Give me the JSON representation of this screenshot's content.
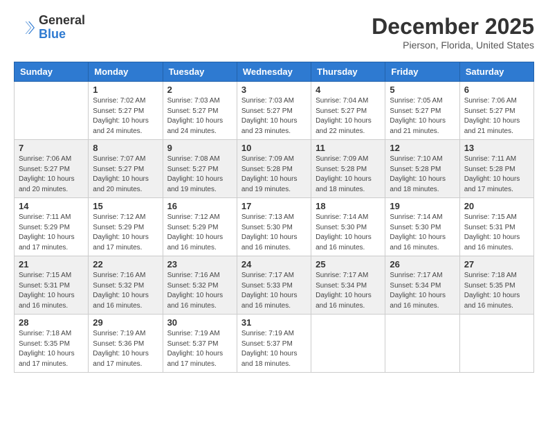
{
  "header": {
    "logo_general": "General",
    "logo_blue": "Blue",
    "month_title": "December 2025",
    "location": "Pierson, Florida, United States"
  },
  "days_of_week": [
    "Sunday",
    "Monday",
    "Tuesday",
    "Wednesday",
    "Thursday",
    "Friday",
    "Saturday"
  ],
  "weeks": [
    [
      {
        "day": "",
        "info": ""
      },
      {
        "day": "1",
        "info": "Sunrise: 7:02 AM\nSunset: 5:27 PM\nDaylight: 10 hours\nand 24 minutes."
      },
      {
        "day": "2",
        "info": "Sunrise: 7:03 AM\nSunset: 5:27 PM\nDaylight: 10 hours\nand 24 minutes."
      },
      {
        "day": "3",
        "info": "Sunrise: 7:03 AM\nSunset: 5:27 PM\nDaylight: 10 hours\nand 23 minutes."
      },
      {
        "day": "4",
        "info": "Sunrise: 7:04 AM\nSunset: 5:27 PM\nDaylight: 10 hours\nand 22 minutes."
      },
      {
        "day": "5",
        "info": "Sunrise: 7:05 AM\nSunset: 5:27 PM\nDaylight: 10 hours\nand 21 minutes."
      },
      {
        "day": "6",
        "info": "Sunrise: 7:06 AM\nSunset: 5:27 PM\nDaylight: 10 hours\nand 21 minutes."
      }
    ],
    [
      {
        "day": "7",
        "info": "Sunrise: 7:06 AM\nSunset: 5:27 PM\nDaylight: 10 hours\nand 20 minutes."
      },
      {
        "day": "8",
        "info": "Sunrise: 7:07 AM\nSunset: 5:27 PM\nDaylight: 10 hours\nand 20 minutes."
      },
      {
        "day": "9",
        "info": "Sunrise: 7:08 AM\nSunset: 5:27 PM\nDaylight: 10 hours\nand 19 minutes."
      },
      {
        "day": "10",
        "info": "Sunrise: 7:09 AM\nSunset: 5:28 PM\nDaylight: 10 hours\nand 19 minutes."
      },
      {
        "day": "11",
        "info": "Sunrise: 7:09 AM\nSunset: 5:28 PM\nDaylight: 10 hours\nand 18 minutes."
      },
      {
        "day": "12",
        "info": "Sunrise: 7:10 AM\nSunset: 5:28 PM\nDaylight: 10 hours\nand 18 minutes."
      },
      {
        "day": "13",
        "info": "Sunrise: 7:11 AM\nSunset: 5:28 PM\nDaylight: 10 hours\nand 17 minutes."
      }
    ],
    [
      {
        "day": "14",
        "info": "Sunrise: 7:11 AM\nSunset: 5:29 PM\nDaylight: 10 hours\nand 17 minutes."
      },
      {
        "day": "15",
        "info": "Sunrise: 7:12 AM\nSunset: 5:29 PM\nDaylight: 10 hours\nand 17 minutes."
      },
      {
        "day": "16",
        "info": "Sunrise: 7:12 AM\nSunset: 5:29 PM\nDaylight: 10 hours\nand 16 minutes."
      },
      {
        "day": "17",
        "info": "Sunrise: 7:13 AM\nSunset: 5:30 PM\nDaylight: 10 hours\nand 16 minutes."
      },
      {
        "day": "18",
        "info": "Sunrise: 7:14 AM\nSunset: 5:30 PM\nDaylight: 10 hours\nand 16 minutes."
      },
      {
        "day": "19",
        "info": "Sunrise: 7:14 AM\nSunset: 5:30 PM\nDaylight: 10 hours\nand 16 minutes."
      },
      {
        "day": "20",
        "info": "Sunrise: 7:15 AM\nSunset: 5:31 PM\nDaylight: 10 hours\nand 16 minutes."
      }
    ],
    [
      {
        "day": "21",
        "info": "Sunrise: 7:15 AM\nSunset: 5:31 PM\nDaylight: 10 hours\nand 16 minutes."
      },
      {
        "day": "22",
        "info": "Sunrise: 7:16 AM\nSunset: 5:32 PM\nDaylight: 10 hours\nand 16 minutes."
      },
      {
        "day": "23",
        "info": "Sunrise: 7:16 AM\nSunset: 5:32 PM\nDaylight: 10 hours\nand 16 minutes."
      },
      {
        "day": "24",
        "info": "Sunrise: 7:17 AM\nSunset: 5:33 PM\nDaylight: 10 hours\nand 16 minutes."
      },
      {
        "day": "25",
        "info": "Sunrise: 7:17 AM\nSunset: 5:34 PM\nDaylight: 10 hours\nand 16 minutes."
      },
      {
        "day": "26",
        "info": "Sunrise: 7:17 AM\nSunset: 5:34 PM\nDaylight: 10 hours\nand 16 minutes."
      },
      {
        "day": "27",
        "info": "Sunrise: 7:18 AM\nSunset: 5:35 PM\nDaylight: 10 hours\nand 16 minutes."
      }
    ],
    [
      {
        "day": "28",
        "info": "Sunrise: 7:18 AM\nSunset: 5:35 PM\nDaylight: 10 hours\nand 17 minutes."
      },
      {
        "day": "29",
        "info": "Sunrise: 7:19 AM\nSunset: 5:36 PM\nDaylight: 10 hours\nand 17 minutes."
      },
      {
        "day": "30",
        "info": "Sunrise: 7:19 AM\nSunset: 5:37 PM\nDaylight: 10 hours\nand 17 minutes."
      },
      {
        "day": "31",
        "info": "Sunrise: 7:19 AM\nSunset: 5:37 PM\nDaylight: 10 hours\nand 18 minutes."
      },
      {
        "day": "",
        "info": ""
      },
      {
        "day": "",
        "info": ""
      },
      {
        "day": "",
        "info": ""
      }
    ]
  ]
}
